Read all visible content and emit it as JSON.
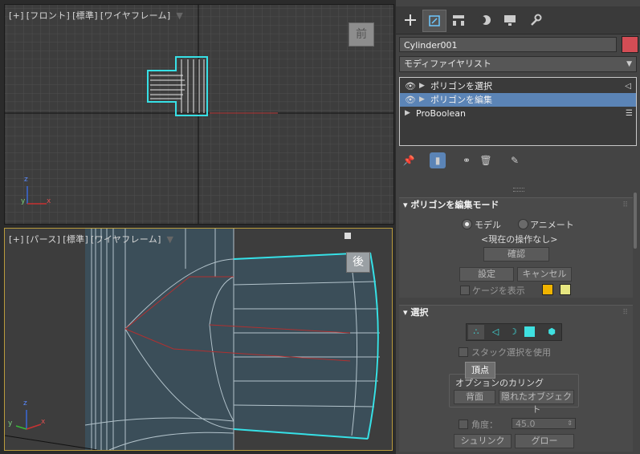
{
  "viewport_front": {
    "labels": [
      "[+]",
      "[フロント]",
      "[標準]",
      "[ワイヤフレーム]"
    ],
    "viewcube_label": "前",
    "axis_z": "z",
    "axis_y": "y",
    "axis_x": "x"
  },
  "viewport_persp": {
    "labels": [
      "[+]",
      "[パース]",
      "[標準]",
      "[ワイヤフレーム]"
    ],
    "viewcube_label": "後",
    "axis_z": "z",
    "axis_y": "y",
    "axis_x": "x"
  },
  "command_panel": {
    "object_name": "Cylinder001",
    "object_color": "#d44d55",
    "modifier_list_label": "モディファイヤリスト",
    "stack": [
      {
        "label": "ポリゴンを選択",
        "selected": false
      },
      {
        "label": "ポリゴンを編集",
        "selected": true
      },
      {
        "label": "ProBoolean",
        "selected": false
      }
    ]
  },
  "edit_mode_rollout": {
    "title": "ポリゴンを編集モード",
    "radio_model": "モデル",
    "radio_animate": "アニメート",
    "current_op": "<現在の操作なし>",
    "confirm_button": "確認",
    "settings_button": "設定",
    "cancel_button": "キャンセル",
    "show_cage_label": "ケージを表示",
    "cage_color_1": "#f0b400",
    "cage_color_2": "#e6e680"
  },
  "selection_rollout": {
    "title": "選択",
    "use_stack_selection_label": "スタック選択を使用",
    "tooltip": "頂点",
    "culling_group_title": "オプションのカリング",
    "backface_button": "背面",
    "hidden_objects_button": "隠れたオブジェクト",
    "angle_label": "角度：",
    "angle_value": "45.0",
    "shrink_button": "シュリンク",
    "grow_button": "グロー"
  }
}
